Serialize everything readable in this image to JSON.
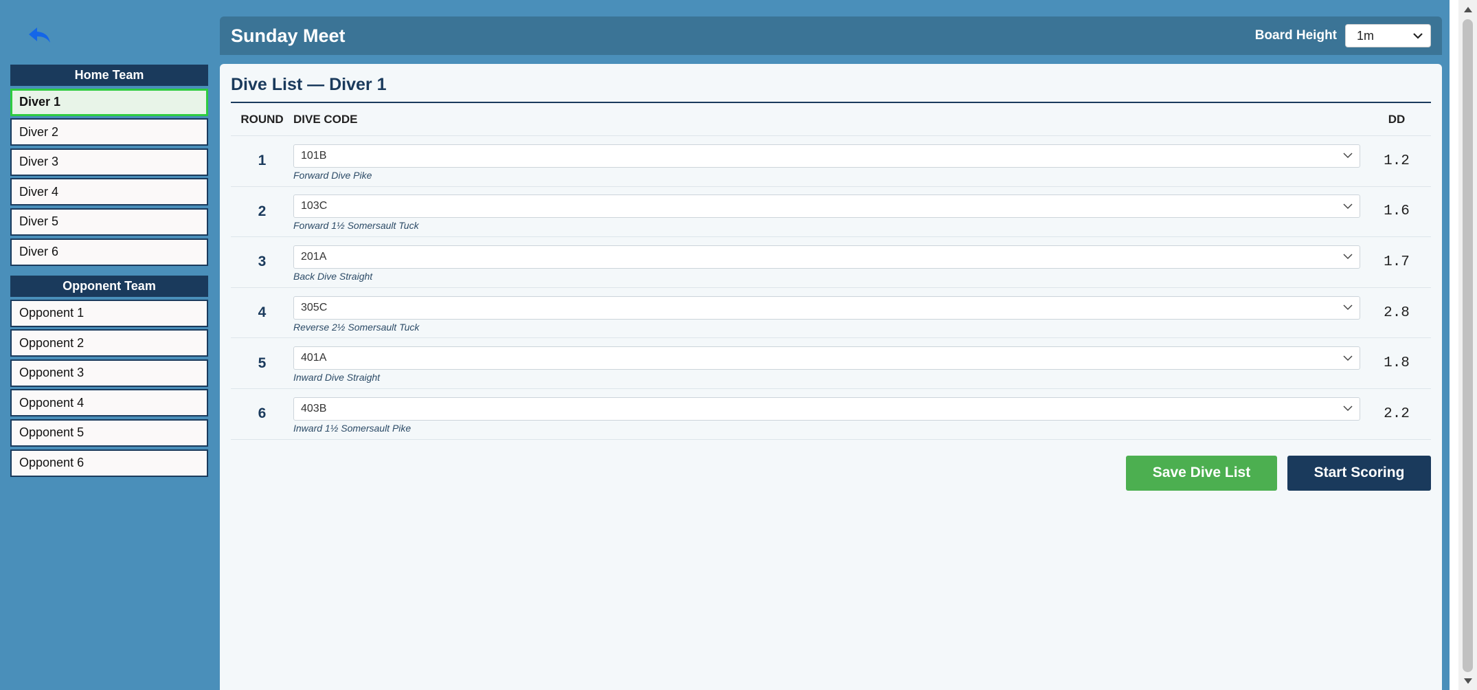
{
  "meet": {
    "title": "Sunday Meet",
    "board_height_label": "Board Height",
    "board_height_value": "1m"
  },
  "sidebar": {
    "home_team_label": "Home Team",
    "home_divers": [
      "Diver 1",
      "Diver 2",
      "Diver 3",
      "Diver 4",
      "Diver 5",
      "Diver 6"
    ],
    "opponent_team_label": "Opponent Team",
    "opponents": [
      "Opponent 1",
      "Opponent 2",
      "Opponent 3",
      "Opponent 4",
      "Opponent 5",
      "Opponent 6"
    ],
    "active": "Diver 1"
  },
  "dive_list": {
    "title": "Dive List — Diver 1",
    "headers": {
      "round": "ROUND",
      "code": "DIVE CODE",
      "dd": "DD"
    },
    "rows": [
      {
        "round": "1",
        "code": "101B",
        "description": "Forward Dive Pike",
        "dd": "1.2"
      },
      {
        "round": "2",
        "code": "103C",
        "description": "Forward 1½ Somersault Tuck",
        "dd": "1.6"
      },
      {
        "round": "3",
        "code": "201A",
        "description": "Back Dive Straight",
        "dd": "1.7"
      },
      {
        "round": "4",
        "code": "305C",
        "description": "Reverse 2½ Somersault Tuck",
        "dd": "2.8"
      },
      {
        "round": "5",
        "code": "401A",
        "description": "Inward Dive Straight",
        "dd": "1.8"
      },
      {
        "round": "6",
        "code": "403B",
        "description": "Inward 1½ Somersault Pike",
        "dd": "2.2"
      }
    ]
  },
  "actions": {
    "save_label": "Save Dive List",
    "start_label": "Start Scoring"
  },
  "colors": {
    "background": "#4a8fba",
    "navy": "#1a3a5c",
    "green": "#4caf50",
    "active_border": "#2ecc40"
  },
  "icons": {
    "back": "back-arrow-icon",
    "dropdown": "chevron-down-icon"
  }
}
